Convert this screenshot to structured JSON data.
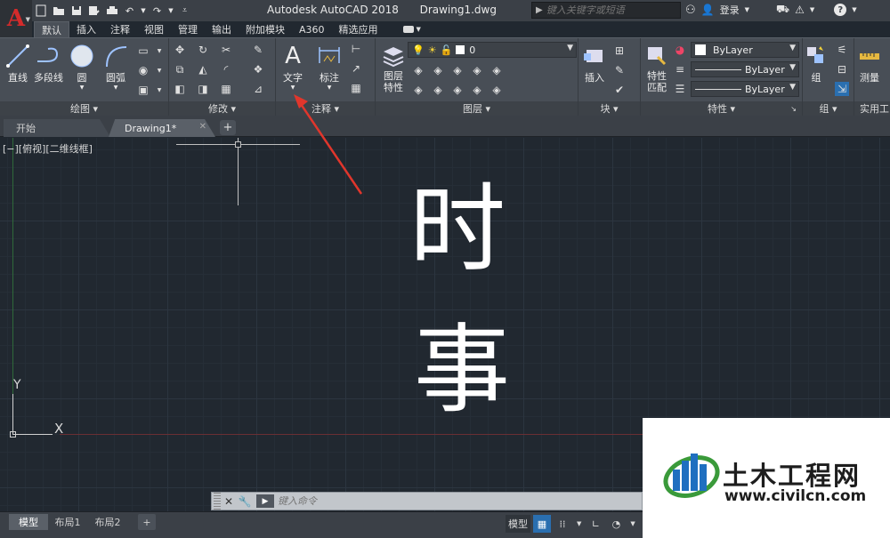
{
  "app": {
    "logo": "A",
    "title": "Autodesk AutoCAD 2018",
    "document": "Drawing1.dwg"
  },
  "search": {
    "placeholder": "键入关键字或短语"
  },
  "account": {
    "login": "登录",
    "help": "?"
  },
  "menu_tabs": [
    "默认",
    "插入",
    "注释",
    "视图",
    "管理",
    "输出",
    "附加模块",
    "A360",
    "精选应用"
  ],
  "ribbon": {
    "draw": {
      "title": "绘图",
      "buttons": [
        "直线",
        "多段线",
        "圆",
        "圆弧"
      ]
    },
    "modify": {
      "title": "修改"
    },
    "annotation": {
      "title": "注释",
      "buttons": [
        "文字",
        "标注"
      ]
    },
    "layers": {
      "title": "图层",
      "button": "图层特性",
      "layer_value": "0"
    },
    "block": {
      "title": "块",
      "button": "插入"
    },
    "properties": {
      "title": "特性",
      "button": "特性匹配",
      "color": "ByLayer",
      "linetype": "ByLayer",
      "lineweight": "ByLayer"
    },
    "groups": {
      "title": "组",
      "button": "组"
    },
    "utilities": {
      "title": "实用工",
      "button": "测量"
    }
  },
  "file_tabs": [
    {
      "label": "开始"
    },
    {
      "label": "Drawing1*"
    }
  ],
  "viewport": {
    "label": "[−][俯视][二维线框]",
    "ucs_x": "X",
    "ucs_y": "Y",
    "text_line1": "时",
    "text_line2": "事"
  },
  "command_line": {
    "placeholder": "键入命令",
    "prompt_icon": "▶"
  },
  "layout_tabs": [
    "模型",
    "布局1",
    "布局2"
  ],
  "status": {
    "model": "模型"
  },
  "watermark": {
    "title": "土木工程网",
    "url": "www.civilcn.com"
  },
  "colors": {
    "accent_red": "#d42b2b",
    "canvas": "#212830",
    "arrow": "#e0362c"
  }
}
